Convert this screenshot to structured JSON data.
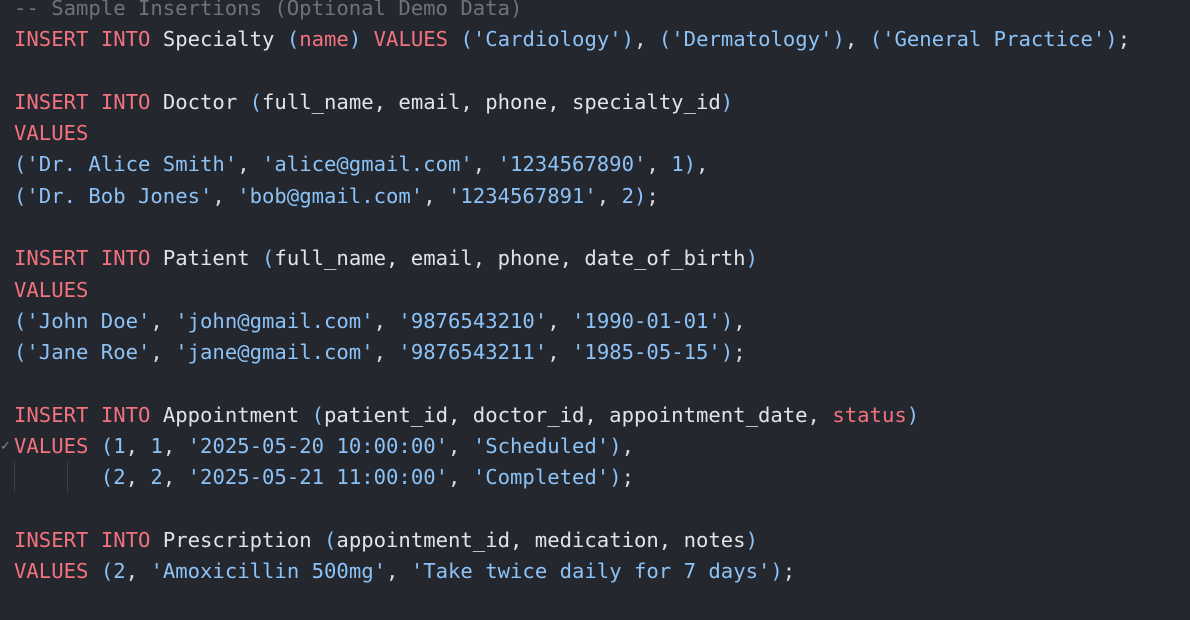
{
  "editor": {
    "lines": [
      [
        {
          "t": "c",
          "v": "-- Sample Insertions (Optional Demo Data)"
        }
      ],
      [
        {
          "t": "k",
          "v": "INSERT"
        },
        {
          "t": "p",
          "v": " "
        },
        {
          "t": "k",
          "v": "INTO"
        },
        {
          "t": "i",
          "v": " Specialty "
        },
        {
          "t": "b",
          "v": "("
        },
        {
          "t": "k",
          "v": "name"
        },
        {
          "t": "b",
          "v": ")"
        },
        {
          "t": "p",
          "v": " "
        },
        {
          "t": "k",
          "v": "VALUES"
        },
        {
          "t": "p",
          "v": " "
        },
        {
          "t": "b",
          "v": "("
        },
        {
          "t": "s",
          "v": "'Cardiology'"
        },
        {
          "t": "b",
          "v": ")"
        },
        {
          "t": "p",
          "v": ", "
        },
        {
          "t": "b",
          "v": "("
        },
        {
          "t": "s",
          "v": "'Dermatology'"
        },
        {
          "t": "b",
          "v": ")"
        },
        {
          "t": "p",
          "v": ", "
        },
        {
          "t": "b",
          "v": "("
        },
        {
          "t": "s",
          "v": "'General Practice'"
        },
        {
          "t": "b",
          "v": ")"
        },
        {
          "t": "p",
          "v": ";"
        }
      ],
      [],
      [
        {
          "t": "k",
          "v": "INSERT"
        },
        {
          "t": "p",
          "v": " "
        },
        {
          "t": "k",
          "v": "INTO"
        },
        {
          "t": "i",
          "v": " Doctor "
        },
        {
          "t": "b",
          "v": "("
        },
        {
          "t": "i",
          "v": "full_name, email, phone, specialty_id"
        },
        {
          "t": "b",
          "v": ")"
        }
      ],
      [
        {
          "t": "k",
          "v": "VALUES"
        }
      ],
      [
        {
          "t": "b",
          "v": "("
        },
        {
          "t": "s",
          "v": "'Dr. Alice Smith'"
        },
        {
          "t": "p",
          "v": ", "
        },
        {
          "t": "s",
          "v": "'alice@gmail.com'"
        },
        {
          "t": "p",
          "v": ", "
        },
        {
          "t": "s",
          "v": "'1234567890'"
        },
        {
          "t": "p",
          "v": ", "
        },
        {
          "t": "n",
          "v": "1"
        },
        {
          "t": "b",
          "v": ")"
        },
        {
          "t": "p",
          "v": ","
        }
      ],
      [
        {
          "t": "b",
          "v": "("
        },
        {
          "t": "s",
          "v": "'Dr. Bob Jones'"
        },
        {
          "t": "p",
          "v": ", "
        },
        {
          "t": "s",
          "v": "'bob@gmail.com'"
        },
        {
          "t": "p",
          "v": ", "
        },
        {
          "t": "s",
          "v": "'1234567891'"
        },
        {
          "t": "p",
          "v": ", "
        },
        {
          "t": "n",
          "v": "2"
        },
        {
          "t": "b",
          "v": ")"
        },
        {
          "t": "p",
          "v": ";"
        }
      ],
      [],
      [
        {
          "t": "k",
          "v": "INSERT"
        },
        {
          "t": "p",
          "v": " "
        },
        {
          "t": "k",
          "v": "INTO"
        },
        {
          "t": "i",
          "v": " Patient "
        },
        {
          "t": "b",
          "v": "("
        },
        {
          "t": "i",
          "v": "full_name, email, phone, date_of_birth"
        },
        {
          "t": "b",
          "v": ")"
        }
      ],
      [
        {
          "t": "k",
          "v": "VALUES"
        }
      ],
      [
        {
          "t": "b",
          "v": "("
        },
        {
          "t": "s",
          "v": "'John Doe'"
        },
        {
          "t": "p",
          "v": ", "
        },
        {
          "t": "s",
          "v": "'john@gmail.com'"
        },
        {
          "t": "p",
          "v": ", "
        },
        {
          "t": "s",
          "v": "'9876543210'"
        },
        {
          "t": "p",
          "v": ", "
        },
        {
          "t": "s",
          "v": "'1990-01-01'"
        },
        {
          "t": "b",
          "v": ")"
        },
        {
          "t": "p",
          "v": ","
        }
      ],
      [
        {
          "t": "b",
          "v": "("
        },
        {
          "t": "s",
          "v": "'Jane Roe'"
        },
        {
          "t": "p",
          "v": ", "
        },
        {
          "t": "s",
          "v": "'jane@gmail.com'"
        },
        {
          "t": "p",
          "v": ", "
        },
        {
          "t": "s",
          "v": "'9876543211'"
        },
        {
          "t": "p",
          "v": ", "
        },
        {
          "t": "s",
          "v": "'1985-05-15'"
        },
        {
          "t": "b",
          "v": ")"
        },
        {
          "t": "p",
          "v": ";"
        }
      ],
      [],
      [
        {
          "t": "k",
          "v": "INSERT"
        },
        {
          "t": "p",
          "v": " "
        },
        {
          "t": "k",
          "v": "INTO"
        },
        {
          "t": "i",
          "v": " Appointment "
        },
        {
          "t": "b",
          "v": "("
        },
        {
          "t": "i",
          "v": "patient_id, doctor_id, appointment_date, "
        },
        {
          "t": "k",
          "v": "status"
        },
        {
          "t": "b",
          "v": ")"
        }
      ],
      [
        {
          "t": "k",
          "v": "VALUES"
        },
        {
          "t": "p",
          "v": " "
        },
        {
          "t": "b",
          "v": "("
        },
        {
          "t": "n",
          "v": "1"
        },
        {
          "t": "p",
          "v": ", "
        },
        {
          "t": "n",
          "v": "1"
        },
        {
          "t": "p",
          "v": ", "
        },
        {
          "t": "s",
          "v": "'2025-05-20 10:00:00'"
        },
        {
          "t": "p",
          "v": ", "
        },
        {
          "t": "s",
          "v": "'Scheduled'"
        },
        {
          "t": "b",
          "v": ")"
        },
        {
          "t": "p",
          "v": ","
        }
      ],
      [
        {
          "t": "p",
          "v": "       "
        },
        {
          "t": "b",
          "v": "("
        },
        {
          "t": "n",
          "v": "2"
        },
        {
          "t": "p",
          "v": ", "
        },
        {
          "t": "n",
          "v": "2"
        },
        {
          "t": "p",
          "v": ", "
        },
        {
          "t": "s",
          "v": "'2025-05-21 11:00:00'"
        },
        {
          "t": "p",
          "v": ", "
        },
        {
          "t": "s",
          "v": "'Completed'"
        },
        {
          "t": "b",
          "v": ")"
        },
        {
          "t": "p",
          "v": ";"
        }
      ],
      [],
      [
        {
          "t": "k",
          "v": "INSERT"
        },
        {
          "t": "p",
          "v": " "
        },
        {
          "t": "k",
          "v": "INTO"
        },
        {
          "t": "i",
          "v": " Prescription "
        },
        {
          "t": "b",
          "v": "("
        },
        {
          "t": "i",
          "v": "appointment_id, medication, notes"
        },
        {
          "t": "b",
          "v": ")"
        }
      ],
      [
        {
          "t": "k",
          "v": "VALUES"
        },
        {
          "t": "p",
          "v": " "
        },
        {
          "t": "b",
          "v": "("
        },
        {
          "t": "n",
          "v": "2"
        },
        {
          "t": "p",
          "v": ", "
        },
        {
          "t": "s",
          "v": "'Amoxicillin 500mg'"
        },
        {
          "t": "p",
          "v": ", "
        },
        {
          "t": "s",
          "v": "'Take twice daily for 7 days'"
        },
        {
          "t": "b",
          "v": ")"
        },
        {
          "t": "p",
          "v": ";"
        }
      ]
    ]
  },
  "colors": {
    "background": "#24272e",
    "keyword": "#f2727e",
    "string": "#8cc2f6",
    "identifier": "#dfe3ea",
    "comment": "#6d737e"
  },
  "icons": {
    "fold_marker_line_14": "checkmark-fold-icon"
  }
}
